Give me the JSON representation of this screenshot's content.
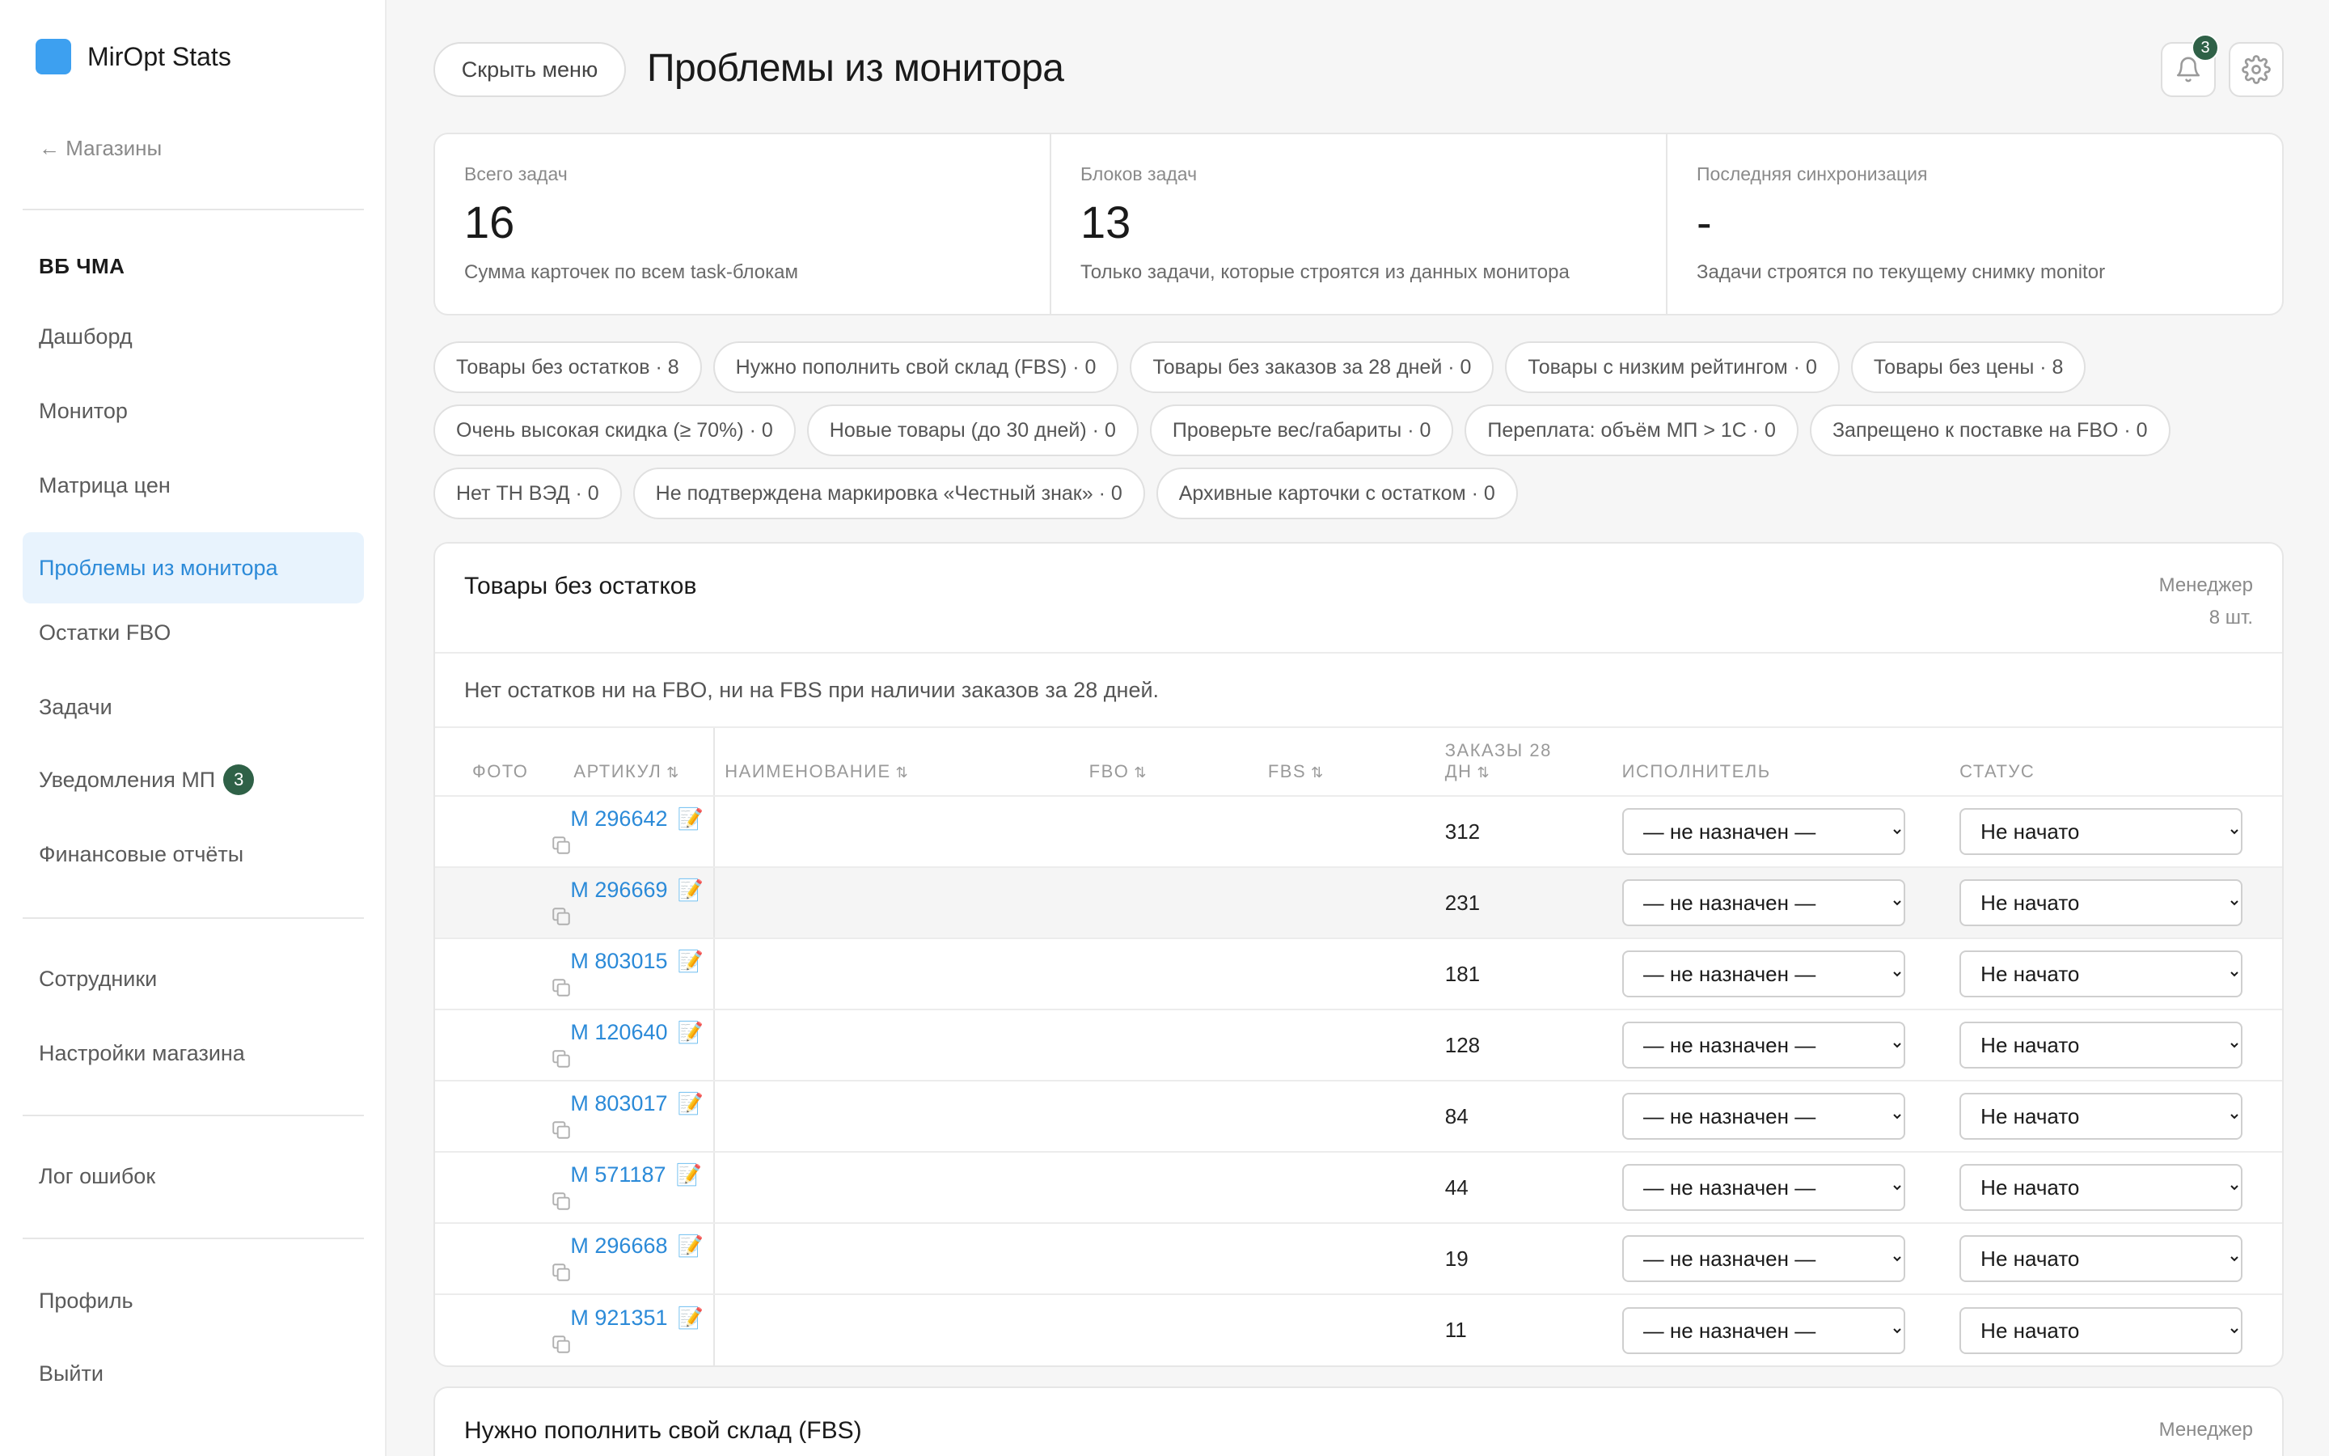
{
  "app": {
    "name": "MirOpt Stats",
    "brand_color": "#3da0f0"
  },
  "sidebar": {
    "back_label": "← Магазины",
    "store_name": "ВБ ЧМА",
    "nav": [
      {
        "label": "Дашборд"
      },
      {
        "label": "Монитор"
      },
      {
        "label": "Матрица цен"
      },
      {
        "label": "Проблемы из монитора",
        "active": true
      },
      {
        "label": "Остатки FBO"
      },
      {
        "label": "Задачи"
      },
      {
        "label": "Уведомления МП",
        "badge": "3"
      },
      {
        "label": "Финансовые отчёты"
      },
      {
        "label": "Сотрудники"
      },
      {
        "label": "Настройки магазина"
      },
      {
        "label": "Лог ошибок"
      },
      {
        "label": "Профиль"
      },
      {
        "label": "Выйти"
      }
    ]
  },
  "header": {
    "hide_menu_label": "Скрыть меню",
    "title": "Проблемы из монитора",
    "notifications_count": "3",
    "bell_icon": "bell-icon",
    "settings_icon": "gear-icon"
  },
  "stats": [
    {
      "label": "Всего задач",
      "value": "16",
      "desc": "Сумма карточек по всем task-блокам"
    },
    {
      "label": "Блоков задач",
      "value": "13",
      "desc": "Только задачи, которые строятся из данных монитора"
    },
    {
      "label": "Последняя синхронизация",
      "value": "-",
      "desc": "Задачи строятся по текущему снимку monitor"
    }
  ],
  "chips": [
    [
      "Товары без остатков · 8",
      "Нужно пополнить свой склад (FBS) · 0",
      "Товары без заказов за 28 дней · 0",
      "Товары с низким рейтингом · 0",
      "Товары без цены · 8"
    ],
    [
      "Очень высокая скидка (≥ 70%) · 0",
      "Новые товары (до 30 дней) · 0",
      "Проверьте вес/габариты · 0",
      "Переплата: объём МП > 1С · 0",
      "Запрещено к поставке на FBO · 0"
    ],
    [
      "Нет ТН ВЭД · 0",
      "Не подтверждена маркировка «Честный знак» · 0",
      "Архивные карточки с остатком · 0"
    ]
  ],
  "block1": {
    "title": "Товары без остатков",
    "meta_role": "Менеджер",
    "meta_count": "8 шт.",
    "desc": "Нет остатков ни на FBO, ни на FBS при наличии заказов за 28 дней.",
    "columns": {
      "photo": "ФОТО",
      "article": "АРТИКУЛ",
      "name": "НАИМЕНОВАНИЕ",
      "fbo": "FBO",
      "fbs": "FBS",
      "orders_line1": "ЗАКАЗЫ 28",
      "orders_line2": "ДН",
      "assignee": "ИСПОЛНИТЕЛЬ",
      "status": "СТАТУС",
      "sort_glyph": "⇅"
    },
    "edit_glyph": "📝",
    "assignee_value": "— не назначен —",
    "status_value": "Не начато",
    "rows": [
      {
        "sku": "М 296642",
        "orders": "312"
      },
      {
        "sku": "М 296669",
        "orders": "231"
      },
      {
        "sku": "М 803015",
        "orders": "181"
      },
      {
        "sku": "М 120640",
        "orders": "128"
      },
      {
        "sku": "М 803017",
        "orders": "84"
      },
      {
        "sku": "М 571187",
        "orders": "44"
      },
      {
        "sku": "М 296668",
        "orders": "19"
      },
      {
        "sku": "М 921351",
        "orders": "11"
      }
    ]
  },
  "block2": {
    "title": "Нужно пополнить свой склад (FBS)",
    "meta_role": "Менеджер"
  }
}
